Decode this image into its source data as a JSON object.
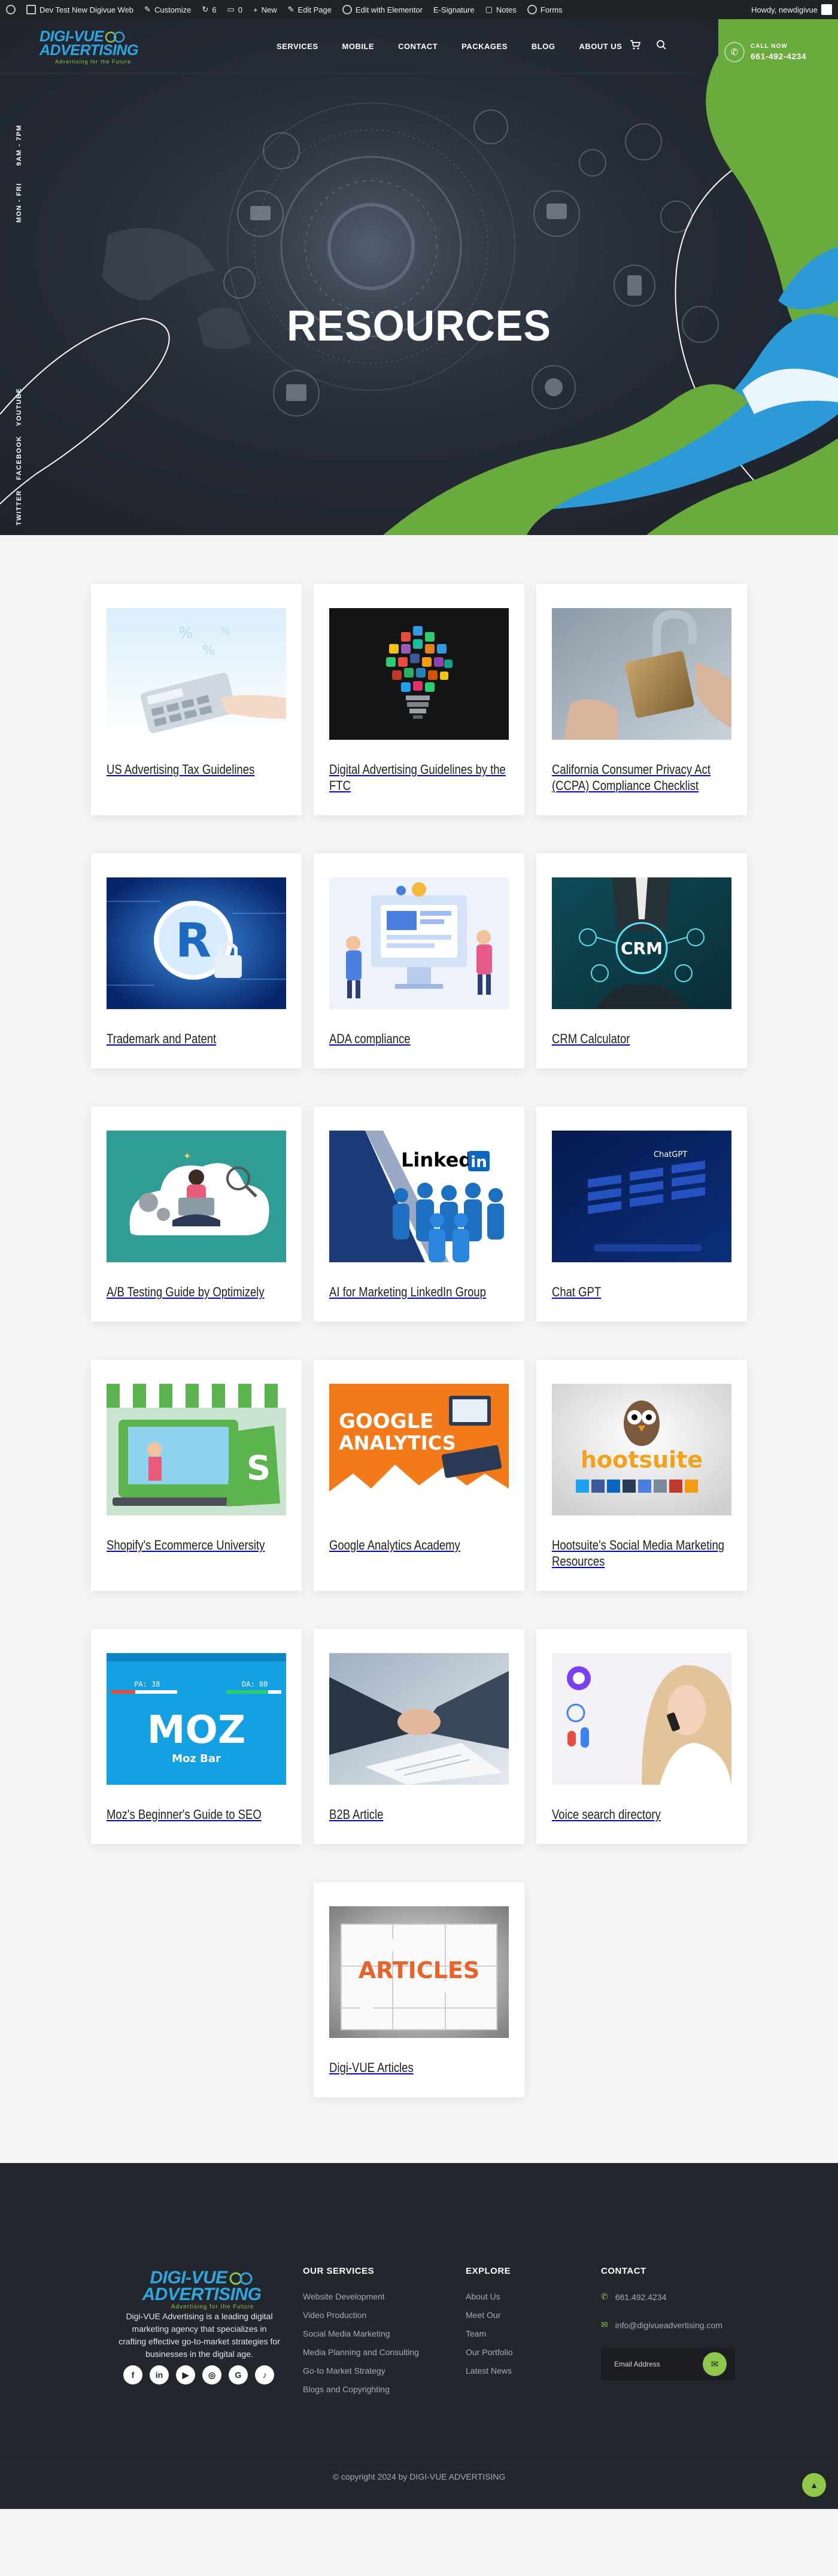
{
  "adminbar": {
    "site_name": "Dev Test New Digivue Web",
    "customize": "Customize",
    "updates": "6",
    "comments": "0",
    "new": "New",
    "edit_page": "Edit Page",
    "elementor": "Edit with Elementor",
    "signature": "E-Signature",
    "notes": "Notes",
    "forms": "Forms",
    "howdy": "Howdy, newdigivue"
  },
  "header": {
    "logo_digi": "DIGI-VUE",
    "logo_adv": "ADVERTISING",
    "logo_tag": "Advertising for the Future",
    "nav": [
      "SERVICES",
      "MOBILE",
      "CONTACT",
      "PACKAGES",
      "BLOG",
      "ABOUT US"
    ],
    "call_label": "CALL NOW",
    "call_number": "661-492-4234"
  },
  "hero": {
    "title": "RESOURCES",
    "side_hours_1": "9AM - 7PM",
    "side_hours_2": "MON - FRI",
    "side_social": [
      "TWITTER",
      "FACEBOOK",
      "YOUTUBE"
    ]
  },
  "cards": [
    {
      "title": "US Advertising Tax Guidelines",
      "thumb": "calculator-image"
    },
    {
      "title": "Digital Advertising Guidelines by the FTC",
      "thumb": "lightbulb-apps-image"
    },
    {
      "title": "California Consumer Privacy Act (CCPA) Compliance Checklist",
      "thumb": "padlock-image"
    },
    {
      "title": "Trademark and Patent",
      "thumb": "registered-trademark-image"
    },
    {
      "title": "ADA compliance",
      "thumb": "ada-illustration-image"
    },
    {
      "title": "CRM Calculator",
      "thumb": "crm-image"
    },
    {
      "title": "A/B Testing Guide by Optimizely",
      "thumb": "ab-testing-illustration-image"
    },
    {
      "title": "AI for Marketing LinkedIn Group",
      "thumb": "linkedin-group-image"
    },
    {
      "title": "Chat GPT",
      "thumb": "chatgpt-screen-image"
    },
    {
      "title": "Shopify's Ecommerce University",
      "thumb": "shopify-image"
    },
    {
      "title": "Google Analytics Academy",
      "thumb": "google-analytics-image"
    },
    {
      "title": "Hootsuite's Social Media Marketing Resources",
      "thumb": "hootsuite-image"
    },
    {
      "title": "Moz's Beginner's Guide to SEO",
      "thumb": "moz-bar-image"
    },
    {
      "title": "B2B Article",
      "thumb": "handshake-image"
    },
    {
      "title": "Voice search directory",
      "thumb": "voice-search-image"
    },
    {
      "title": "Digi-VUE Articles",
      "thumb": "articles-puzzle-image"
    }
  ],
  "thumb_text": {
    "linkedin": "Linked",
    "linkedin_in": "in",
    "crm": "CRM",
    "chatgpt": "ChatGPT",
    "google_1": "GOOGLE",
    "google_2": "ANALYTICS",
    "hootsuite": "hootsuite",
    "moz": "MOZ",
    "mozbar": "Moz Bar",
    "pa": "PA: 38",
    "da": "DA: 80",
    "articles": "ARTICLES"
  },
  "footer": {
    "about": "Digi-VUE Advertising is a leading digital marketing agency that specializes in crafting effective go-to-market strategies for businesses in the digital age.",
    "services_title": "OUR SERVICES",
    "services": [
      "Website Development",
      "Video Production",
      "Social Media Marketing",
      "Media Planning and Consulting",
      "Go-to Market Strategy",
      "Blogs and Copyrighting"
    ],
    "explore_title": "EXPLORE",
    "explore": [
      "About Us",
      "Meet Our",
      "Team",
      "Our Portfolio",
      "Latest News"
    ],
    "contact_title": "CONTACT",
    "phone": "661.492.4234",
    "email": "info@digivueadvertising.com",
    "email_placeholder": "Email Address",
    "copyright": "© copyright 2024 by DIGI-VUE ADVERTISING"
  },
  "colors": {
    "brand_blue": "#2ea7e0",
    "brand_green": "#8fc74a",
    "dark": "#24262d"
  }
}
